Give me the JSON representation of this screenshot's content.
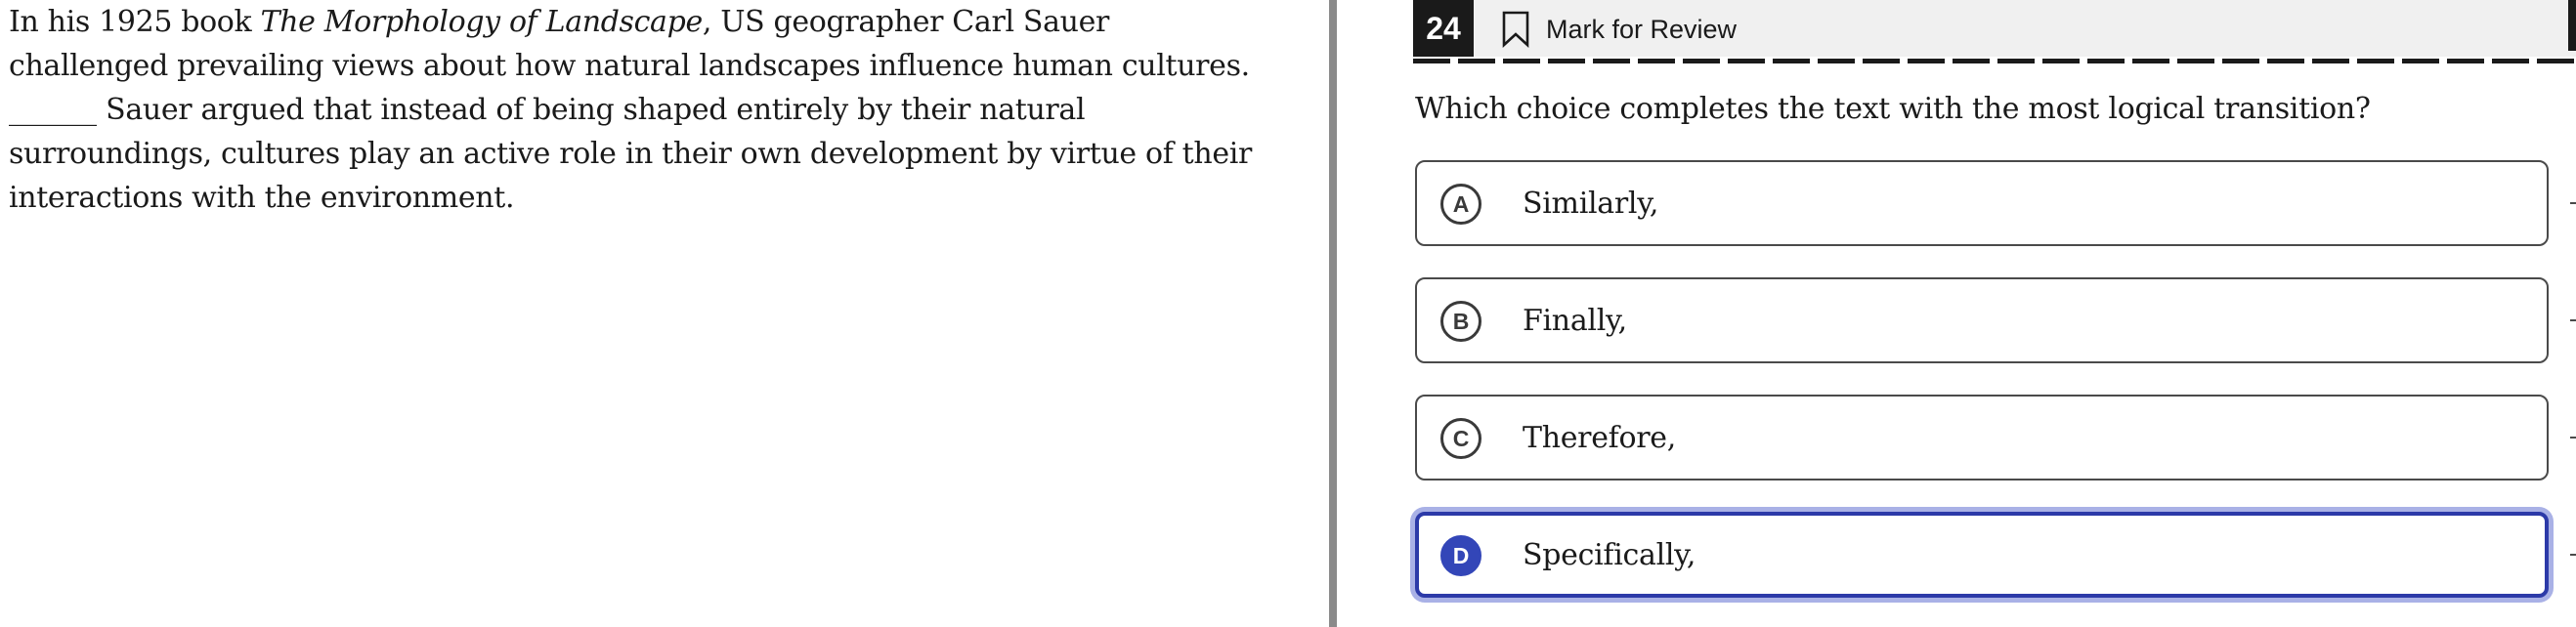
{
  "passage": {
    "segment_1": "In his 1925 book ",
    "book_title": "The Morphology of Landscape",
    "segment_2": ", US geographer Carl Sauer challenged prevailing views about how natural landscapes influence human cultures. ",
    "blank": "______",
    "segment_3": " Sauer argued that instead of being shaped entirely by their natural surroundings, cultures play an active role in their own development by virtue of their interactions with the environment."
  },
  "question": {
    "number": "24",
    "mark_for_review_label": "Mark for Review",
    "prompt": "Which choice completes the text with the most logical transition?",
    "selected_choice": "D",
    "choices": [
      {
        "letter": "A",
        "text": "Similarly,"
      },
      {
        "letter": "B",
        "text": "Finally,"
      },
      {
        "letter": "C",
        "text": "Therefore,"
      },
      {
        "letter": "D",
        "text": "Specifically,"
      }
    ]
  },
  "icons": {
    "bookmark": "bookmark-outline-icon"
  },
  "colors": {
    "selected_border": "#2c3aa8",
    "selected_glow": "#a9b1e6",
    "selected_letter_fill": "#3346b8",
    "question_number_bg": "#1a1a1a",
    "header_bg": "#f0f0f0",
    "divider": "#8a8a8a"
  }
}
